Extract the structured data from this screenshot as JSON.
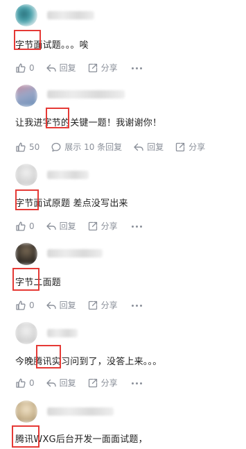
{
  "colors": {
    "highlight": "#e53935",
    "meta": "#8a8f99",
    "text": "#222222"
  },
  "comments": [
    {
      "text": "字节面试题。。。唉",
      "like_count": "0",
      "reply_label": "回复",
      "share_label": "分享"
    },
    {
      "text": "让我进字节的关键一题！我谢谢你！",
      "like_count": "50",
      "expand_label": "展示 10 条回复",
      "reply_label": "回复",
      "share_label": "分享"
    },
    {
      "text": "字节面试原题 差点没写出来",
      "like_count": "0",
      "reply_label": "回复",
      "share_label": "分享"
    },
    {
      "text": "字节二面题",
      "like_count": "0",
      "reply_label": "回复",
      "share_label": "分享"
    },
    {
      "text": "今晚腾讯实习问到了，没答上来。。。",
      "like_count": "0",
      "reply_label": "回复",
      "share_label": "分享"
    },
    {
      "text": "腾讯WXG后台开发一面面试题，"
    }
  ]
}
